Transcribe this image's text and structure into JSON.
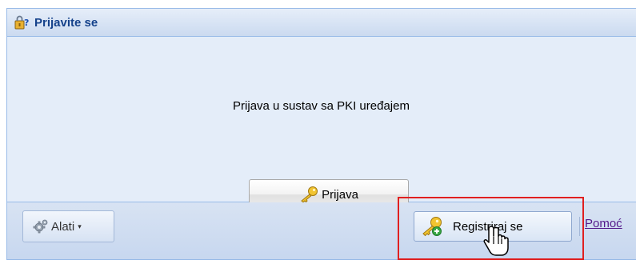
{
  "panel": {
    "title": "Prijavite se",
    "header_icon": "lock-question-icon"
  },
  "body": {
    "login_text": "Prijava u sustav sa PKI uređajem",
    "login_button": {
      "label": "Prijava",
      "icon": "key-icon"
    }
  },
  "toolbar": {
    "tools_button": {
      "label": "Alati",
      "icon": "gear-icon",
      "caret": "▾"
    },
    "register_button": {
      "label": "Registriraj se",
      "icon": "key-add-icon"
    },
    "help_link": "Pomoć"
  },
  "overlay": {
    "highlight_color": "#e02020",
    "cursor": "hand-pointer-icon"
  },
  "colors": {
    "header_title": "#15428b",
    "panel_border": "#99bbe8",
    "body_bg": "#e4edf9"
  }
}
